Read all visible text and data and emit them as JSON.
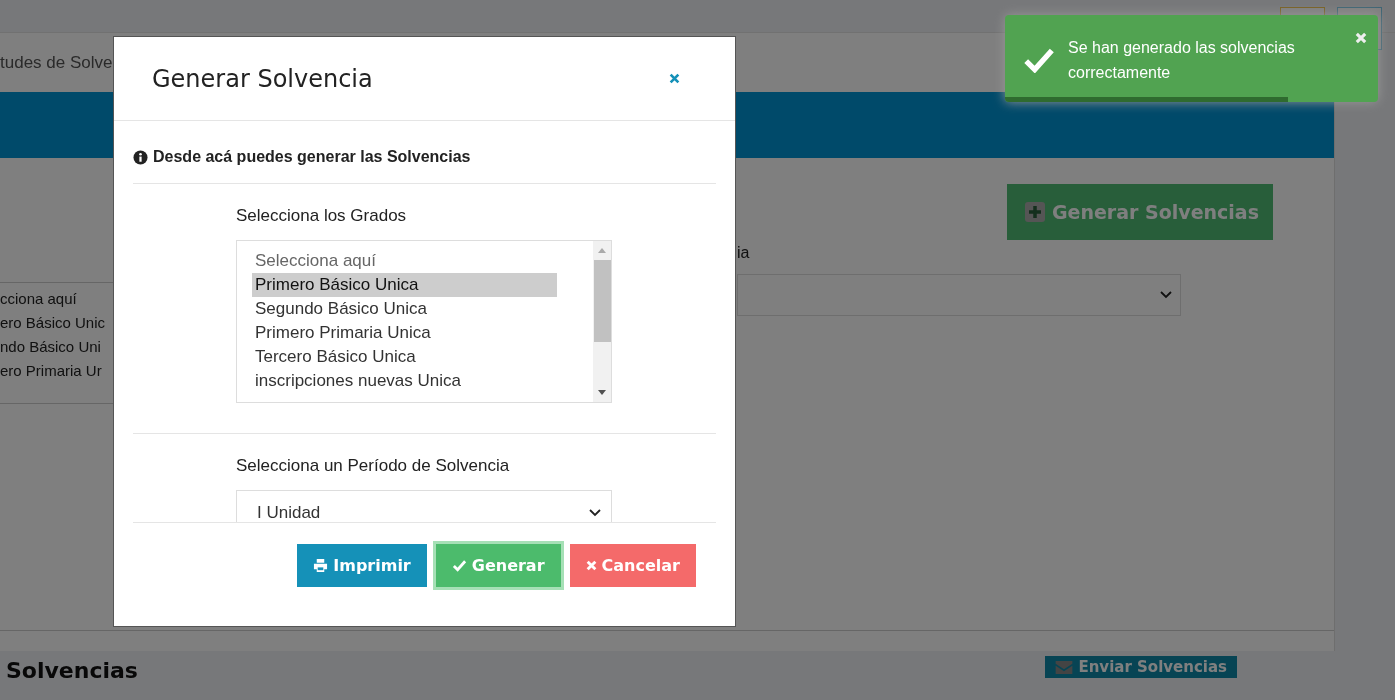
{
  "background": {
    "breadcrumb": "tudes de Solve",
    "generate_button": "Generar Solvencias",
    "grade_options": [
      "cciona aquí",
      "ero Básico Unic",
      "ndo Básico Uni",
      "ero Primaria Ur"
    ],
    "period_label": "ia",
    "section_title": "Solvencias",
    "send_button": "Enviar Solvencias"
  },
  "modal": {
    "title": "Generar Solvencia",
    "info": "Desde acá puedes generar las Solvencias",
    "grades_label": "Selecciona los Grados",
    "grades": [
      {
        "label": "Selecciona aquí",
        "selected": false,
        "placeholder": true
      },
      {
        "label": "Primero Básico Unica",
        "selected": true
      },
      {
        "label": "Segundo Básico Unica",
        "selected": false
      },
      {
        "label": "Primero Primaria Unica",
        "selected": false
      },
      {
        "label": "Tercero Básico Unica",
        "selected": false
      },
      {
        "label": "inscripciones nuevas Unica",
        "selected": false
      }
    ],
    "period_label": "Selecciona un Período de Solvencia",
    "period_value": "I Unidad",
    "buttons": [
      {
        "label": "Imprimir",
        "kind": "print",
        "focused": false
      },
      {
        "label": "Generar",
        "kind": "generate",
        "focused": true
      },
      {
        "label": "Cancelar",
        "kind": "cancel",
        "focused": false
      }
    ]
  },
  "toast": {
    "message": "Se han generado las solvencias correctamente",
    "level": 0.76
  }
}
